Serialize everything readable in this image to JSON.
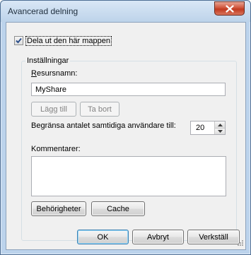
{
  "window": {
    "title": "Avancerad delning",
    "close_symbol": "✕"
  },
  "share": {
    "checkbox_label": "Dela ut den här mappen",
    "checked": true
  },
  "settings": {
    "group_title": "Inställningar",
    "share_name_label": "Resursnamn:",
    "share_name_value": "MyShare",
    "add_button": "Lägg till",
    "remove_button": "Ta bort",
    "limit_label": "Begränsa antalet samtidiga användare till:",
    "limit_value": "20",
    "comments_label": "Kommentarer:",
    "comments_value": "",
    "permissions_button": "Behörigheter",
    "cache_button": "Cache"
  },
  "footer": {
    "ok": "OK",
    "cancel": "Avbryt",
    "apply": "Verkställ"
  },
  "colors": {
    "titlebar": "#bdd3ea",
    "close": "#c13a1f",
    "client": "#f0f0f0"
  },
  "icons": [
    "close-icon",
    "checkmark-icon",
    "spin-up-icon",
    "spin-down-icon",
    "resize-grip-icon"
  ]
}
